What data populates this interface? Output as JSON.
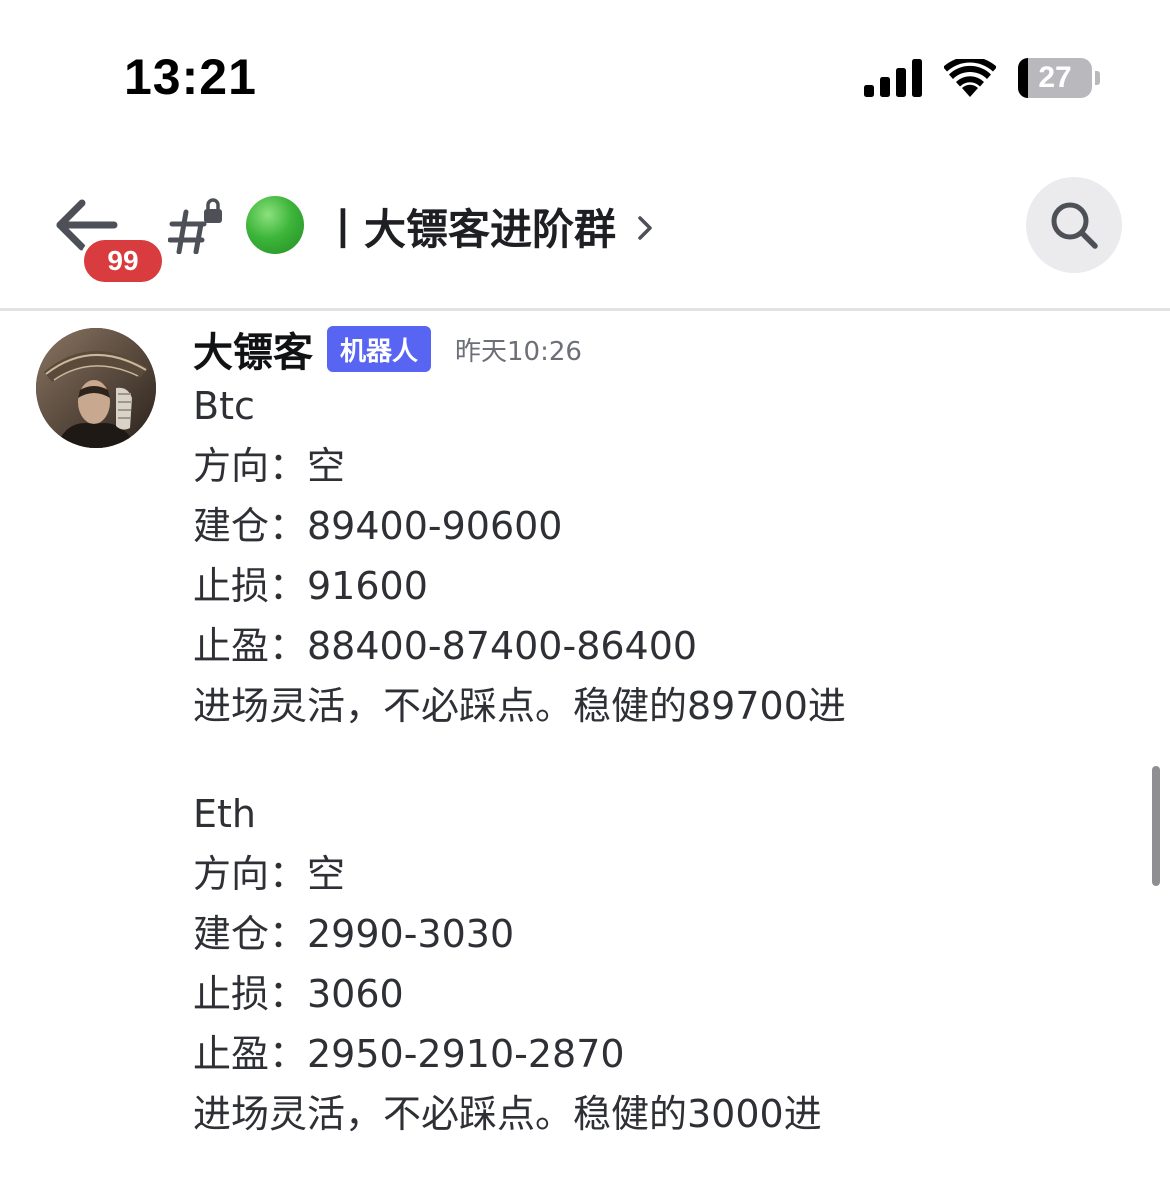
{
  "status_bar": {
    "time": "13:21",
    "battery_level": "27",
    "icons": [
      "cellular-signal-icon",
      "wifi-icon",
      "battery-icon"
    ]
  },
  "header": {
    "unread_count": "99",
    "channel_type_icon": "locked-channel-icon",
    "status_emoji": "green-circle",
    "channel_name": "丨大镖客进阶群",
    "search_icon": "search-icon"
  },
  "message": {
    "author": "大镖客",
    "bot_tag": "机器人",
    "timestamp": "昨天10:26",
    "lines": [
      "Btc",
      "方向：空",
      "建仓：89400-90600",
      "止损：91600",
      "止盈：88400-87400-86400",
      "进场灵活，不必踩点。稳健的89700进",
      "",
      "Eth",
      "方向：空",
      "建仓：2990-3030",
      "止损：3060",
      "止盈：2950-2910-2870",
      "进场灵活，不必踩点。稳健的3000进"
    ]
  },
  "colors": {
    "bot_tag": "#5865f2",
    "badge": "#d83c3e",
    "status_dot": "#3db53a"
  }
}
